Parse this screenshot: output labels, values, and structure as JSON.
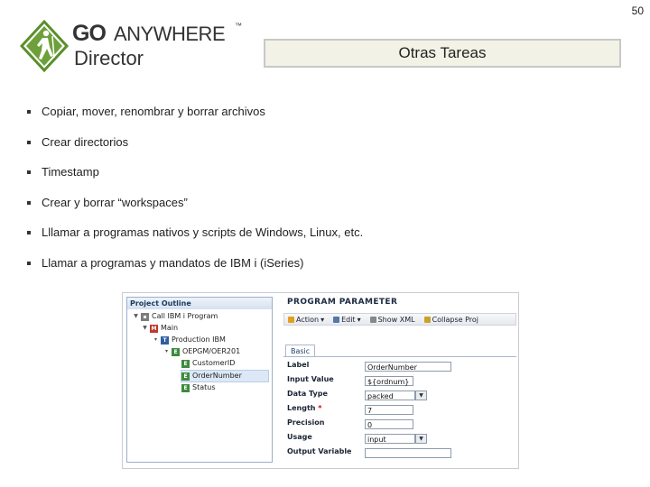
{
  "page_number": "50",
  "logo": {
    "go": "GO",
    "anywhere": "ANYWHERE",
    "tm": "™",
    "director": "Director"
  },
  "title": "Otras Tareas",
  "bullets": [
    "Copiar, mover, renombrar y borrar archivos",
    "Crear directorios",
    "Timestamp",
    "Crear y borrar “workspaces”",
    "Lllamar a programas nativos y scripts de Windows, Linux, etc.",
    "Llamar a programas y mandatos de IBM i (iSeries)"
  ],
  "screenshot": {
    "project_outline": {
      "title": "Project Outline",
      "tree": [
        {
          "label": "Call IBM i Program",
          "icon": "program-icon"
        },
        {
          "label": "Main",
          "icon": "module-icon"
        },
        {
          "label": "Production IBM",
          "icon": "task-icon"
        },
        {
          "label": "OEPGM/OER201",
          "icon": "element-icon"
        },
        {
          "label": "CustomerID",
          "icon": "element-icon"
        },
        {
          "label": "OrderNumber",
          "icon": "element-icon"
        },
        {
          "label": "Status",
          "icon": "element-icon"
        }
      ]
    },
    "program_parameter": {
      "title": "PROGRAM PARAMETER",
      "toolbar": [
        "Action",
        "Edit",
        "Show XML",
        "Collapse Proj"
      ],
      "tab": "Basic",
      "fields": [
        {
          "label": "Label",
          "value": "OrderNumber"
        },
        {
          "label": "Input Value",
          "value": "${ordnum}"
        },
        {
          "label": "Data Type",
          "value": "packed"
        },
        {
          "label": "Length",
          "value": "7",
          "required": "*"
        },
        {
          "label": "Precision",
          "value": "0"
        },
        {
          "label": "Usage",
          "value": "input"
        },
        {
          "label": "Output Variable",
          "value": ""
        }
      ]
    }
  }
}
